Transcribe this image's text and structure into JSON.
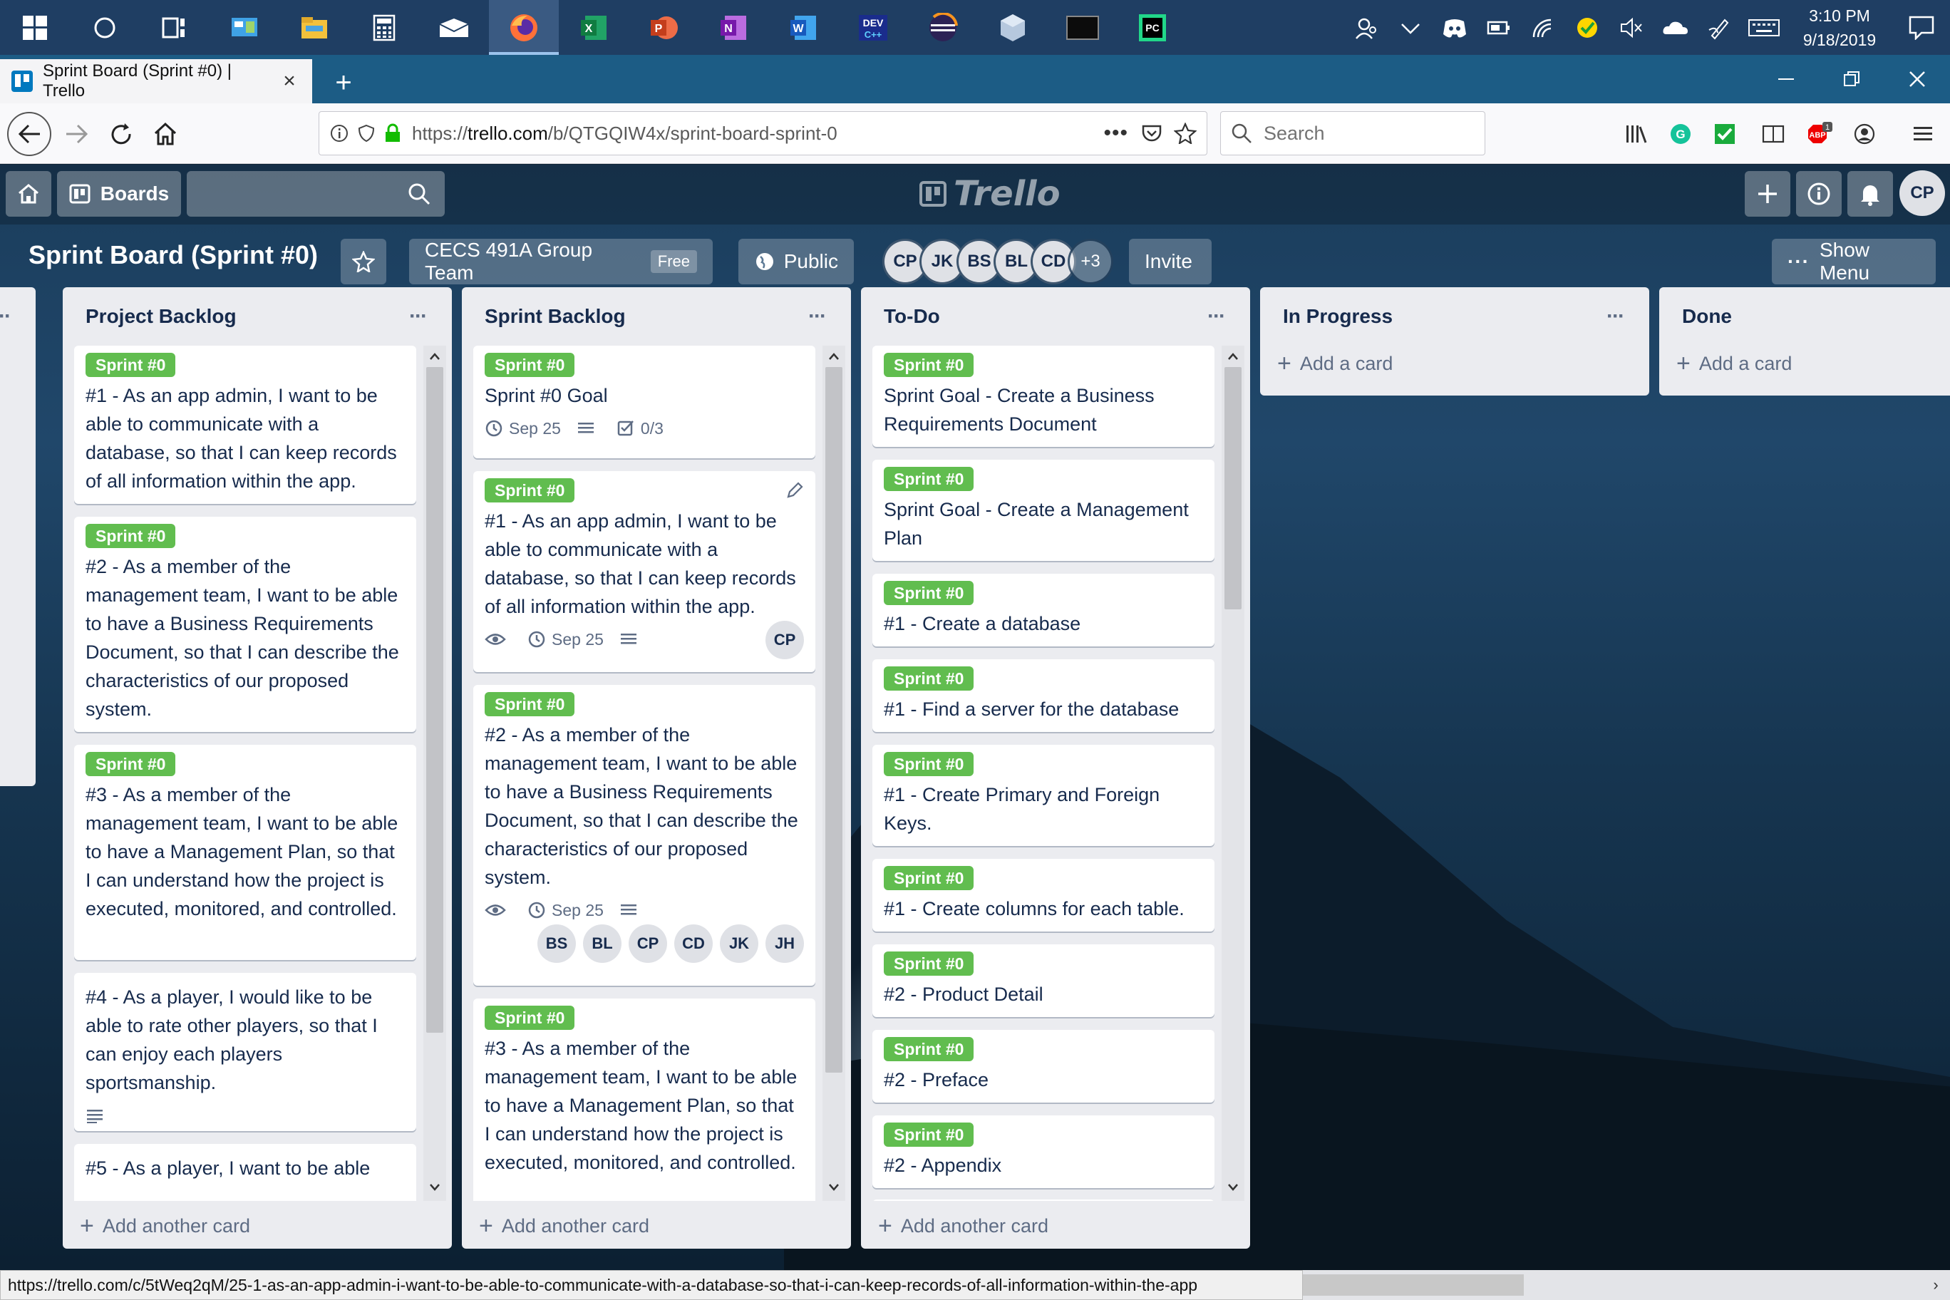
{
  "taskbar": {
    "pinned": [
      "windows-start-icon",
      "search-circle-icon",
      "task-view-icon",
      "control-panel-icon",
      "file-explorer-icon",
      "calculator-icon",
      "mail-icon",
      "firefox-icon",
      "excel-icon",
      "powerpoint-icon",
      "onenote-icon",
      "word-icon",
      "devc-icon",
      "eclipse-icon",
      "virtualbox-icon",
      "terminal-icon",
      "pycharm-icon"
    ],
    "clock_time": "3:10 PM",
    "clock_date": "9/18/2019"
  },
  "browser": {
    "tab_title": "Sprint Board (Sprint #0) | Trello",
    "url_prefix": "https://",
    "url_host": "trello.com",
    "url_path": "/b/QTGQIW4x/sprint-board-sprint-0",
    "search_placeholder": "Search",
    "status_url": "https://trello.com/c/5tWeq2qM/25-1-as-an-app-admin-i-want-to-be-able-to-communicate-with-a-database-so-that-i-can-keep-records-of-all-information-within-the-app"
  },
  "header": {
    "boards_label": "Boards",
    "logo_text": "Trello",
    "user_initials": "CP"
  },
  "board": {
    "title": "Sprint Board (Sprint #0)",
    "team_name": "CECS 491A Group Team",
    "team_badge": "Free",
    "visibility": "Public",
    "members": [
      "CP",
      "JK",
      "BS",
      "BL",
      "CD"
    ],
    "members_more": "+3",
    "invite_label": "Invite",
    "show_menu_label": "Show Menu"
  },
  "lists": {
    "menu_glyph": "···",
    "add_another": "Add another card",
    "add_card": "Add a card",
    "label_text": "Sprint #0",
    "project_backlog": {
      "title": "Project Backlog",
      "cards": [
        "#1 - As an app admin, I want to be able to communicate with a database, so that I can keep records of all information within the app.",
        "#2 - As a member of the management team, I want to be able to have a Business Requirements Document, so that I can describe the characteristics of our proposed system.",
        "#3 - As a member of the management team, I want to be able to have a Management Plan, so that I can understand how the project is executed, monitored, and controlled.",
        "#4 - As a player, I would like to be able to rate other players, so that I can enjoy each players sportsmanship.",
        "#5 - As a player, I want to be able"
      ]
    },
    "sprint_backlog": {
      "title": "Sprint Backlog",
      "cards": [
        {
          "text": "Sprint #0 Goal",
          "date": "Sep 25",
          "checklist": "0/3"
        },
        {
          "text": "#1 - As an app admin, I want to be able to communicate with a database, so that I can keep records of all information within the app.",
          "date": "Sep 25",
          "members": [
            "CP"
          ]
        },
        {
          "text": "#2 - As a member of the management team, I want to be able to have a Business Requirements Document, so that I can describe the characteristics of our proposed system.",
          "date": "Sep 25",
          "members": [
            "BS",
            "BL",
            "CP",
            "CD",
            "JK",
            "JH"
          ]
        },
        {
          "text": "#3 - As a member of the management team, I want to be able to have a Management Plan, so that I can understand how the project is executed, monitored, and controlled."
        }
      ]
    },
    "todo": {
      "title": "To-Do",
      "cards": [
        "Sprint Goal - Create a Business Requirements Document",
        "Sprint Goal - Create a Management Plan",
        "#1 - Create a database",
        "#1 - Find a server for the database",
        "#1 - Create Primary and Foreign Keys.",
        "#1 - Create columns for each table.",
        "#2 - Product Detail",
        "#2 - Preface",
        "#2 - Appendix"
      ]
    },
    "in_progress": {
      "title": "In Progress"
    },
    "done": {
      "title": "Done"
    }
  }
}
